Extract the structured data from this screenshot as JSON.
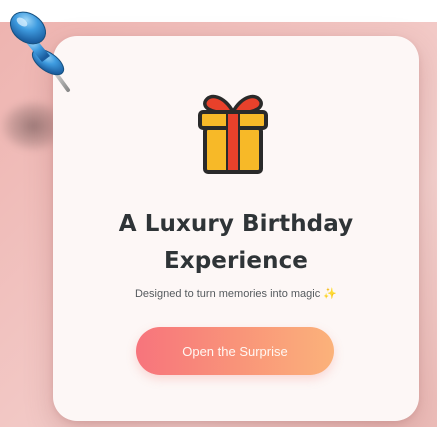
{
  "card": {
    "title": "A Luxury Birthday Experience",
    "subtitle": "Designed to turn memories into magic",
    "subtitle_emoji": "✨",
    "button_label": "Open the Surprise"
  },
  "icons": {
    "gift": "gift-icon",
    "pin": "pushpin-icon",
    "sparkle": "sparkle-icon"
  },
  "colors": {
    "background": "#f1c2bf",
    "card": "#fdf7f6",
    "title": "#2f3437",
    "button_start": "#f7747c",
    "button_end": "#fbb27a",
    "gift_box": "#f7b928",
    "gift_ribbon": "#e8412b"
  }
}
